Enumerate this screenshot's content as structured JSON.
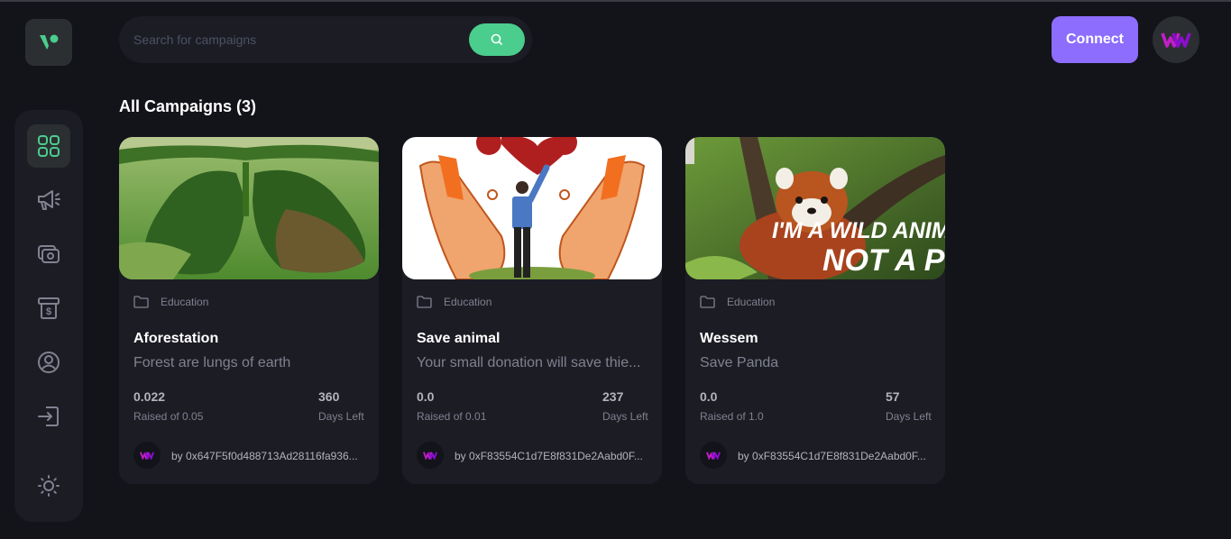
{
  "search": {
    "placeholder": "Search for campaigns",
    "icon": "search-icon"
  },
  "header": {
    "connect_label": "Connect"
  },
  "sidebar": {
    "items": [
      {
        "name": "dashboard",
        "icon": "dashboard-grid-icon",
        "active": true
      },
      {
        "name": "campaign",
        "icon": "megaphone-icon"
      },
      {
        "name": "payment",
        "icon": "payment-icon"
      },
      {
        "name": "withdraw",
        "icon": "withdraw-icon"
      },
      {
        "name": "profile",
        "icon": "profile-icon"
      },
      {
        "name": "logout",
        "icon": "logout-icon"
      }
    ],
    "theme_icon": "sun-icon"
  },
  "main": {
    "heading": "All Campaigns (3)",
    "campaigns": [
      {
        "category": "Education",
        "title": "Aforestation",
        "description": "Forest are lungs of earth",
        "raised": "0.022",
        "raised_label": "Raised of 0.05",
        "days": "360",
        "days_label": "Days Left",
        "owner_prefix": "by",
        "owner": "0x647F5f0d488713Ad28116fa936..."
      },
      {
        "category": "Education",
        "title": "Save animal",
        "description": "Your small donation will save thie...",
        "raised": "0.0",
        "raised_label": "Raised of 0.01",
        "days": "237",
        "days_label": "Days Left",
        "owner_prefix": "by",
        "owner": "0xF83554C1d7E8f831De2Aabd0F..."
      },
      {
        "category": "Education",
        "title": "Wessem",
        "description": "Save Panda",
        "raised": "0.0",
        "raised_label": "Raised of 1.0",
        "days": "57",
        "days_label": "Days Left",
        "owner_prefix": "by",
        "owner": "0xF83554C1d7E8f831De2Aabd0F...",
        "image_caption_line1": "I'M A WILD ANIMAL",
        "image_caption_line2": "NOT A PET"
      }
    ]
  },
  "colors": {
    "accent": "#4acd8d",
    "connect": "#8c6dfd",
    "card": "#1c1c24",
    "background": "#13131a"
  }
}
